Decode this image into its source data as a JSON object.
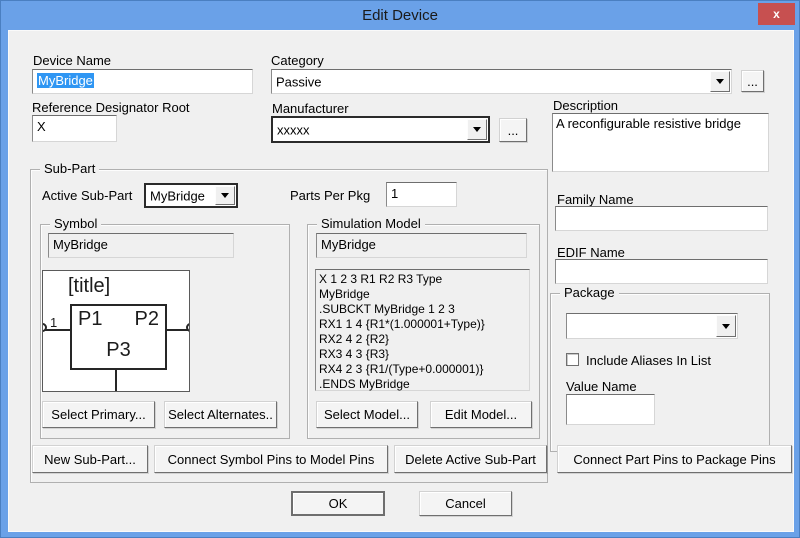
{
  "window": {
    "title": "Edit Device",
    "close_glyph": "x",
    "titlebar_color": "#6aa1e8",
    "close_color": "#c75050",
    "dialog_bg": "#f0f0f0"
  },
  "fields": {
    "device_name": {
      "label": "Device Name",
      "value": "MyBridge"
    },
    "category": {
      "label": "Category",
      "value": "Passive"
    },
    "ref_des_root": {
      "label": "Reference Designator Root",
      "value": "X"
    },
    "manufacturer": {
      "label": "Manufacturer",
      "value": "xxxxx"
    },
    "description": {
      "label": "Description",
      "value": "A reconfigurable resistive bridge"
    },
    "family_name": {
      "label": "Family Name",
      "value": ""
    },
    "edif_name": {
      "label": "EDIF Name",
      "value": ""
    }
  },
  "subpart": {
    "group_label": "Sub-Part",
    "active_subpart": {
      "label": "Active Sub-Part",
      "value": "MyBridge"
    },
    "parts_per_pkg": {
      "label": "Parts Per Pkg",
      "value": "1"
    },
    "symbol": {
      "group_label": "Symbol",
      "name": "MyBridge",
      "preview": {
        "title": "[title]",
        "pin1": "P1",
        "pin2": "P2",
        "pin3": "P3",
        "left_pin_number": "1"
      },
      "select_primary": "Select Primary...",
      "select_alternates": "Select Alternates.."
    },
    "simulation_model": {
      "group_label": "Simulation Model",
      "name": "MyBridge",
      "model_text": "X 1 2 3 R1 R2 R3 Type\nMyBridge\n.SUBCKT MyBridge 1 2 3\nRX1 1 4 {R1*(1.000001+Type)}\nRX2 4 2 {R2}\nRX3 4 3 {R3}\nRX4 2 3 {R1/(Type+0.000001)}\n.ENDS MyBridge",
      "select_model": "Select Model...",
      "edit_model": "Edit Model..."
    },
    "buttons": {
      "new_subpart": "New Sub-Part...",
      "connect_symbol_pins": "Connect Symbol Pins to Model Pins",
      "delete_active": "Delete Active Sub-Part"
    }
  },
  "package": {
    "group_label": "Package",
    "dropdown_value": "",
    "include_aliases_label": "Include Aliases In List",
    "value_name_label": "Value Name",
    "value_name_value": ""
  },
  "actions": {
    "connect_part_pins": "Connect Part Pins to Package Pins",
    "ok": "OK",
    "cancel": "Cancel"
  },
  "misc": {
    "ellipsis": "..."
  }
}
